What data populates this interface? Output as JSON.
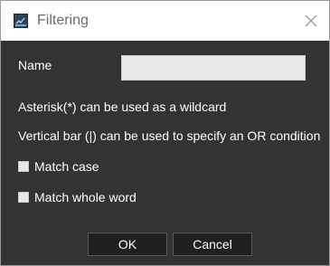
{
  "window": {
    "title": "Filtering",
    "icon": "filter-app-icon",
    "close_icon": "close-icon"
  },
  "form": {
    "name_label": "Name",
    "name_value": "",
    "name_placeholder": "",
    "hint_wildcard": "Asterisk(*) can be used as a wildcard",
    "hint_or": "Vertical bar (|) can be used to specify an OR condition",
    "match_case_label": "Match case",
    "match_case_checked": false,
    "match_whole_word_label": "Match whole word",
    "match_whole_word_checked": false
  },
  "buttons": {
    "ok_label": "OK",
    "cancel_label": "Cancel"
  },
  "colors": {
    "background": "#333333",
    "titlebar": "#ffffff",
    "text": "#ffffff",
    "button_bg": "#1f1f1f"
  }
}
